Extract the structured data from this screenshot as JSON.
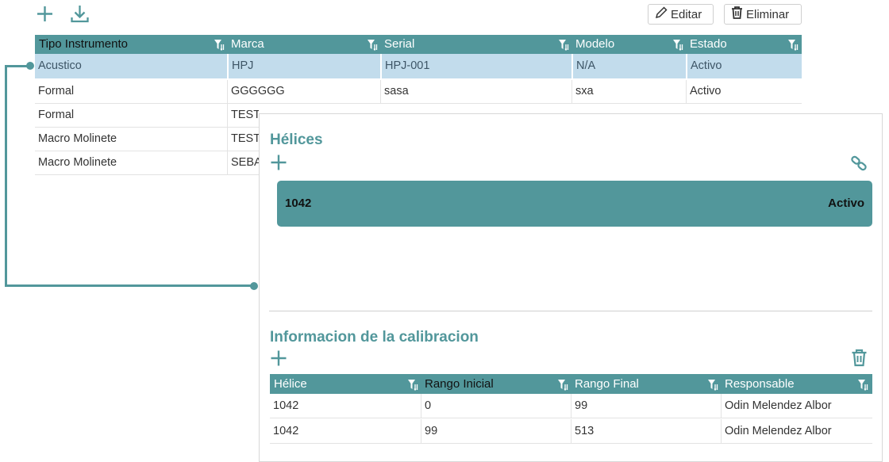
{
  "toolbar": {
    "add_icon": "plus-icon",
    "download_icon": "download-icon",
    "edit_label": "Editar",
    "delete_label": "Eliminar"
  },
  "main_table": {
    "columns": [
      "Tipo Instrumento",
      "Marca",
      "Serial",
      "Modelo",
      "Estado"
    ],
    "rows": [
      [
        "Acustico",
        "HPJ",
        "HPJ-001",
        "N/A",
        "Activo"
      ],
      [
        "Formal",
        "GGGGGG",
        "sasa",
        "sxa",
        "Activo"
      ],
      [
        "Formal",
        "TEST",
        "",
        "",
        ""
      ],
      [
        "Macro Molinete",
        "TEST",
        "",
        "",
        ""
      ],
      [
        "Macro Molinete",
        "SEBA",
        "",
        "",
        ""
      ]
    ],
    "selected_row": 0
  },
  "detail": {
    "helices_title": "Hélices",
    "helice_card": {
      "id": "1042",
      "status": "Activo"
    },
    "calibration_title": "Informacion de la calibracion",
    "calibration_table": {
      "columns": [
        "Hélice",
        "Rango Inicial",
        "Rango Final",
        "Responsable"
      ],
      "rows": [
        [
          "1042",
          "0",
          "99",
          "Odin Melendez Albor"
        ],
        [
          "1042",
          "99",
          "513",
          "Odin Melendez Albor"
        ]
      ]
    }
  },
  "colors": {
    "accent": "#52979b",
    "selected_row": "#c2dcec"
  }
}
